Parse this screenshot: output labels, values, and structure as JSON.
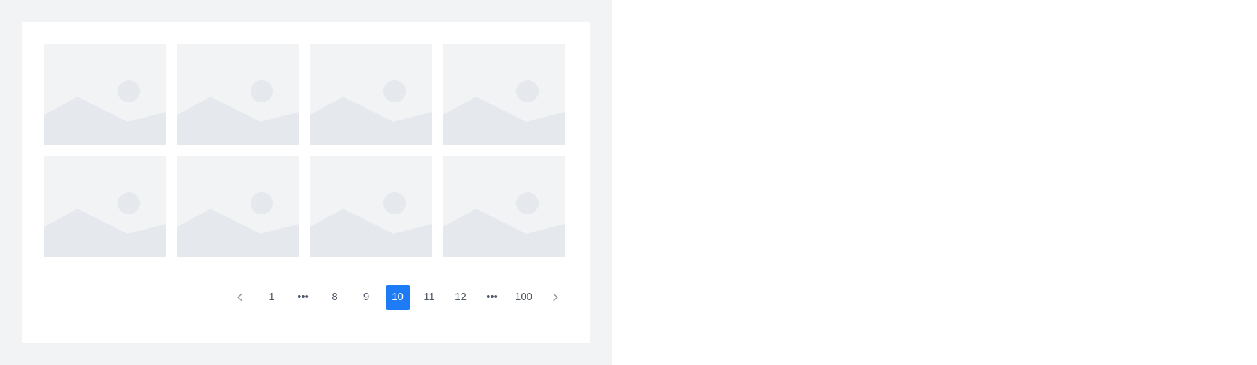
{
  "colors": {
    "page_background": "#f2f3f5",
    "card_background": "#ffffff",
    "placeholder_background": "#f2f3f5",
    "placeholder_shape": "#e5e8ed",
    "accent": "#1d7bf5",
    "page_text": "#4e5969"
  },
  "gallery": {
    "items": [
      {
        "icon": "image-placeholder-icon"
      },
      {
        "icon": "image-placeholder-icon"
      },
      {
        "icon": "image-placeholder-icon"
      },
      {
        "icon": "image-placeholder-icon"
      },
      {
        "icon": "image-placeholder-icon"
      },
      {
        "icon": "image-placeholder-icon"
      },
      {
        "icon": "image-placeholder-icon"
      },
      {
        "icon": "image-placeholder-icon"
      }
    ]
  },
  "pagination": {
    "prev_icon": "chevron-left-icon",
    "next_icon": "chevron-right-icon",
    "ellipsis": "•••",
    "pages": [
      "1",
      "8",
      "9",
      "10",
      "11",
      "12",
      "100"
    ],
    "current": "10"
  }
}
